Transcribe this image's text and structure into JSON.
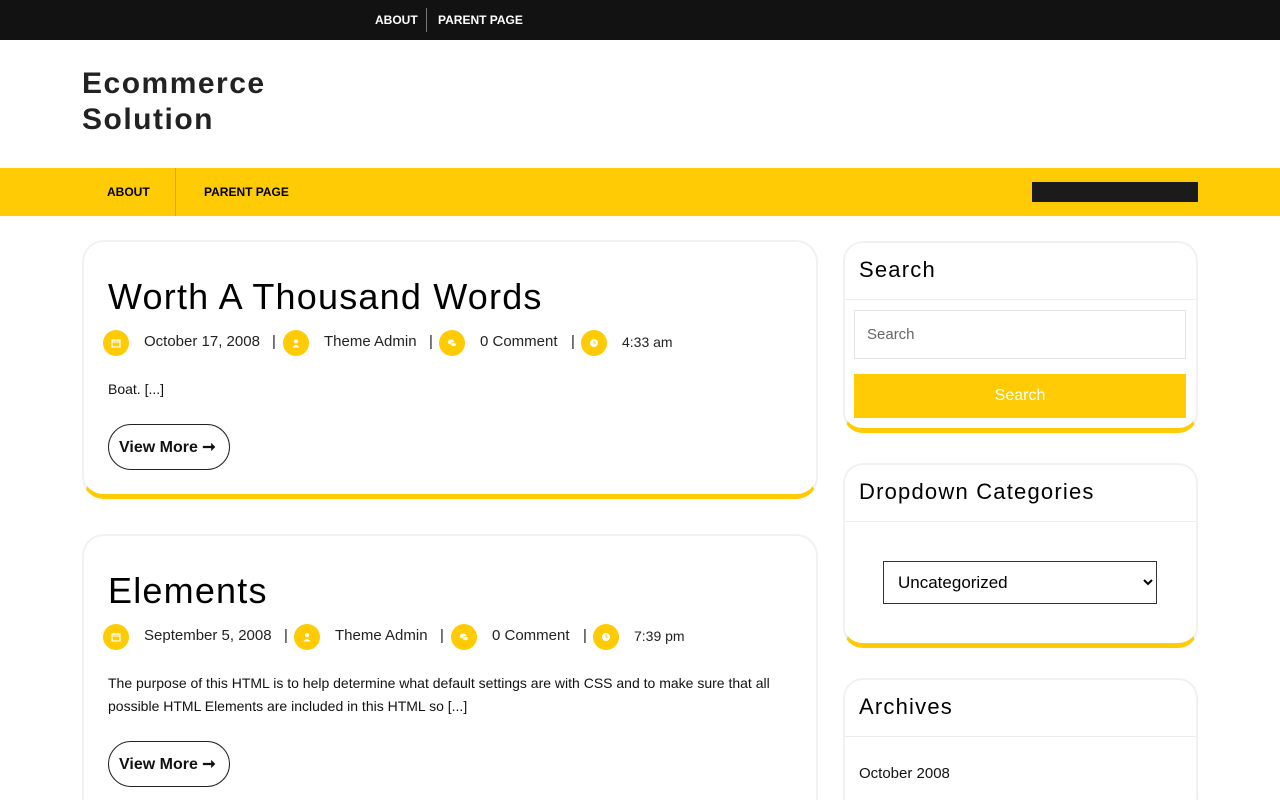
{
  "topbar": {
    "about": "ABOUT",
    "parent_page": "PARENT PAGE"
  },
  "site": {
    "title_line1": "Ecommerce",
    "title_line2": "Solution"
  },
  "mainnav": {
    "about": "ABOUT",
    "parent_page": "PARENT PAGE"
  },
  "posts": [
    {
      "title": "Worth A Thousand Words",
      "date": "October 17, 2008",
      "author": "Theme Admin",
      "comments": "0 Comment",
      "time": "4:33 am",
      "excerpt": "Boat. [...]",
      "more_label": "View More ➞"
    },
    {
      "title": "Elements",
      "date": "September 5, 2008",
      "author": "Theme Admin",
      "comments": "0 Comment",
      "time": "7:39 pm",
      "excerpt": "The purpose of this HTML is to help determine what default settings are with CSS and to make sure that all possible HTML Elements are included in this HTML so [...]",
      "more_label": "View More ➞"
    }
  ],
  "meta_separator": "|",
  "sidebar": {
    "search": {
      "title": "Search",
      "placeholder": "Search",
      "button": "Search"
    },
    "categories": {
      "title": "Dropdown Categories",
      "selected": "Uncategorized"
    },
    "archives": {
      "title": "Archives",
      "items": [
        "October 2008"
      ]
    }
  },
  "colors": {
    "accent": "#ffcb05",
    "topbar": "#121212",
    "text": "#000000"
  },
  "icons": {
    "date": "calendar-icon",
    "author": "user-icon",
    "comments": "comments-icon",
    "time": "clock-icon"
  }
}
